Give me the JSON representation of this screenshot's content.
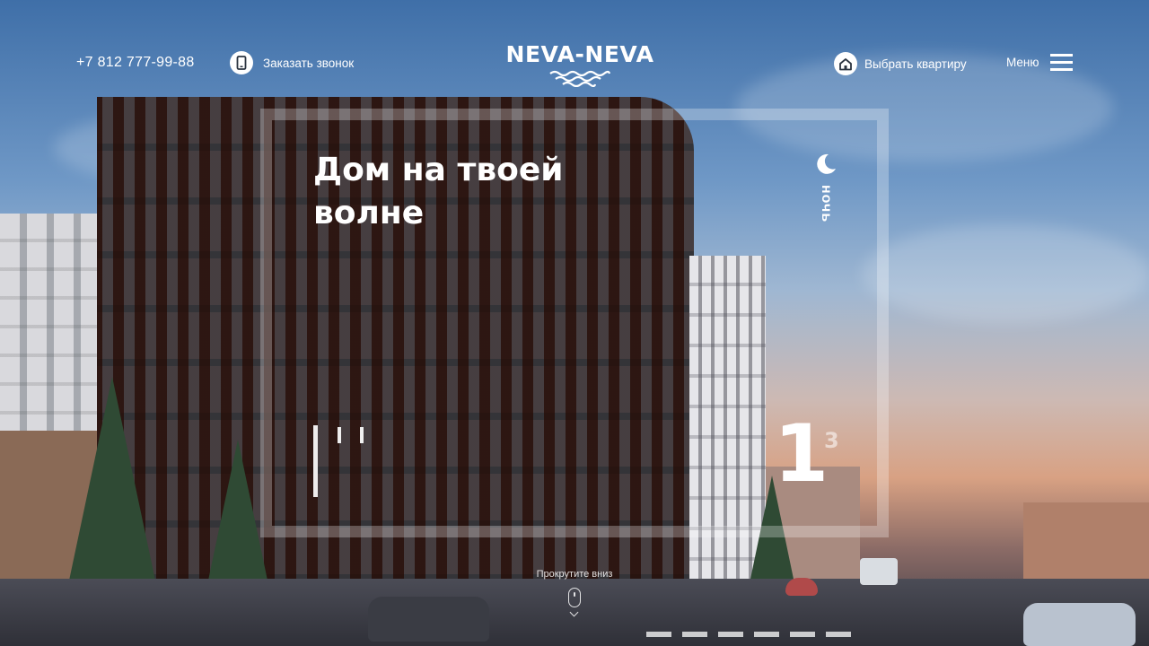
{
  "header": {
    "phone": "+7 812 777-99-88",
    "callback_label": "Заказать звонок",
    "callback_icon": "phone-icon",
    "logo_text": "NEVA-NEVA",
    "logo_icon": "waves-icon",
    "choose_apartment_label": "Выбрать квартиру",
    "choose_apartment_icon": "house-icon",
    "menu_label": "Меню",
    "menu_icon": "hamburger-icon"
  },
  "hero": {
    "title": "Дом на твоей волне",
    "night_toggle_label": "ночь",
    "night_toggle_icon": "moon-icon"
  },
  "slider": {
    "current": "1",
    "total": "3"
  },
  "scroll_hint": {
    "label": "Прокрутите вниз",
    "icon": "mouse-icon"
  },
  "colors": {
    "text": "#ffffff",
    "frame": "rgba(255,255,255,0.28)",
    "building_brick": "#5a2e24"
  }
}
